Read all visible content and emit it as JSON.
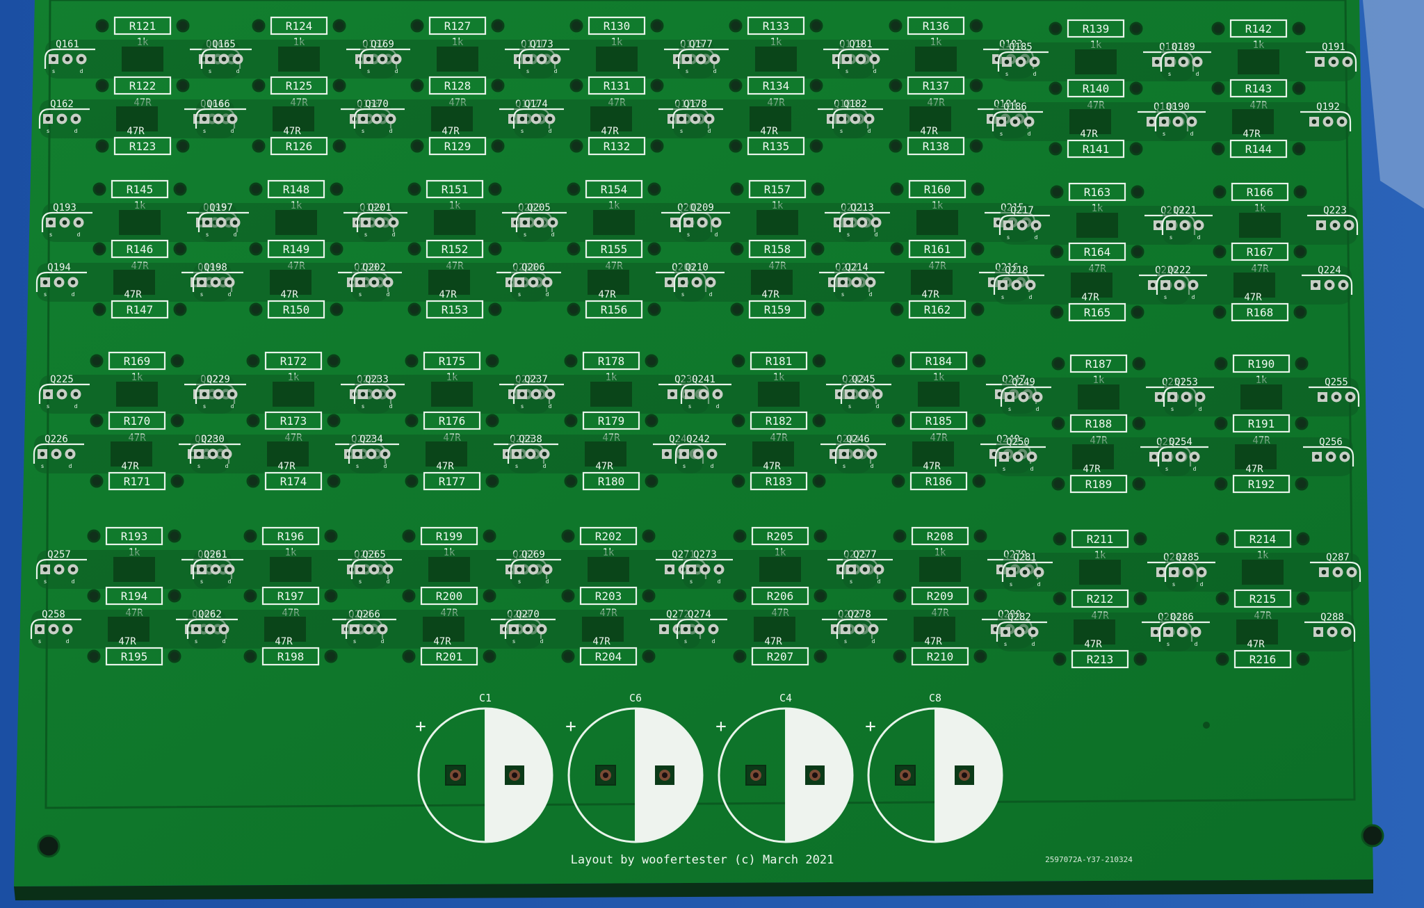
{
  "board": {
    "colors": {
      "background_blue": "#1a4d9e",
      "pcb_green": "#0f7a2c",
      "pcb_green_dark": "#0b5e22",
      "copper_fill": "#0d5a22",
      "silkscreen": "#e8f4ea",
      "pad_ring": "#c8cfc6",
      "drill": "#10301a"
    },
    "footer_text": "Layout by woofertester (c) March 2021",
    "order_code": "2597072A-Y37-210324",
    "resistor_values": {
      "top": "1k",
      "mid": "47R",
      "bottom": "47R"
    },
    "capacitors": [
      "C1",
      "C6",
      "C4",
      "C8"
    ],
    "rows": [
      {
        "r_start": 121,
        "q_start": 161
      },
      {
        "r_start": 145,
        "q_start": 193
      },
      {
        "r_start": 169,
        "q_start": 225
      },
      {
        "r_start": 193,
        "q_start": 257
      }
    ]
  }
}
